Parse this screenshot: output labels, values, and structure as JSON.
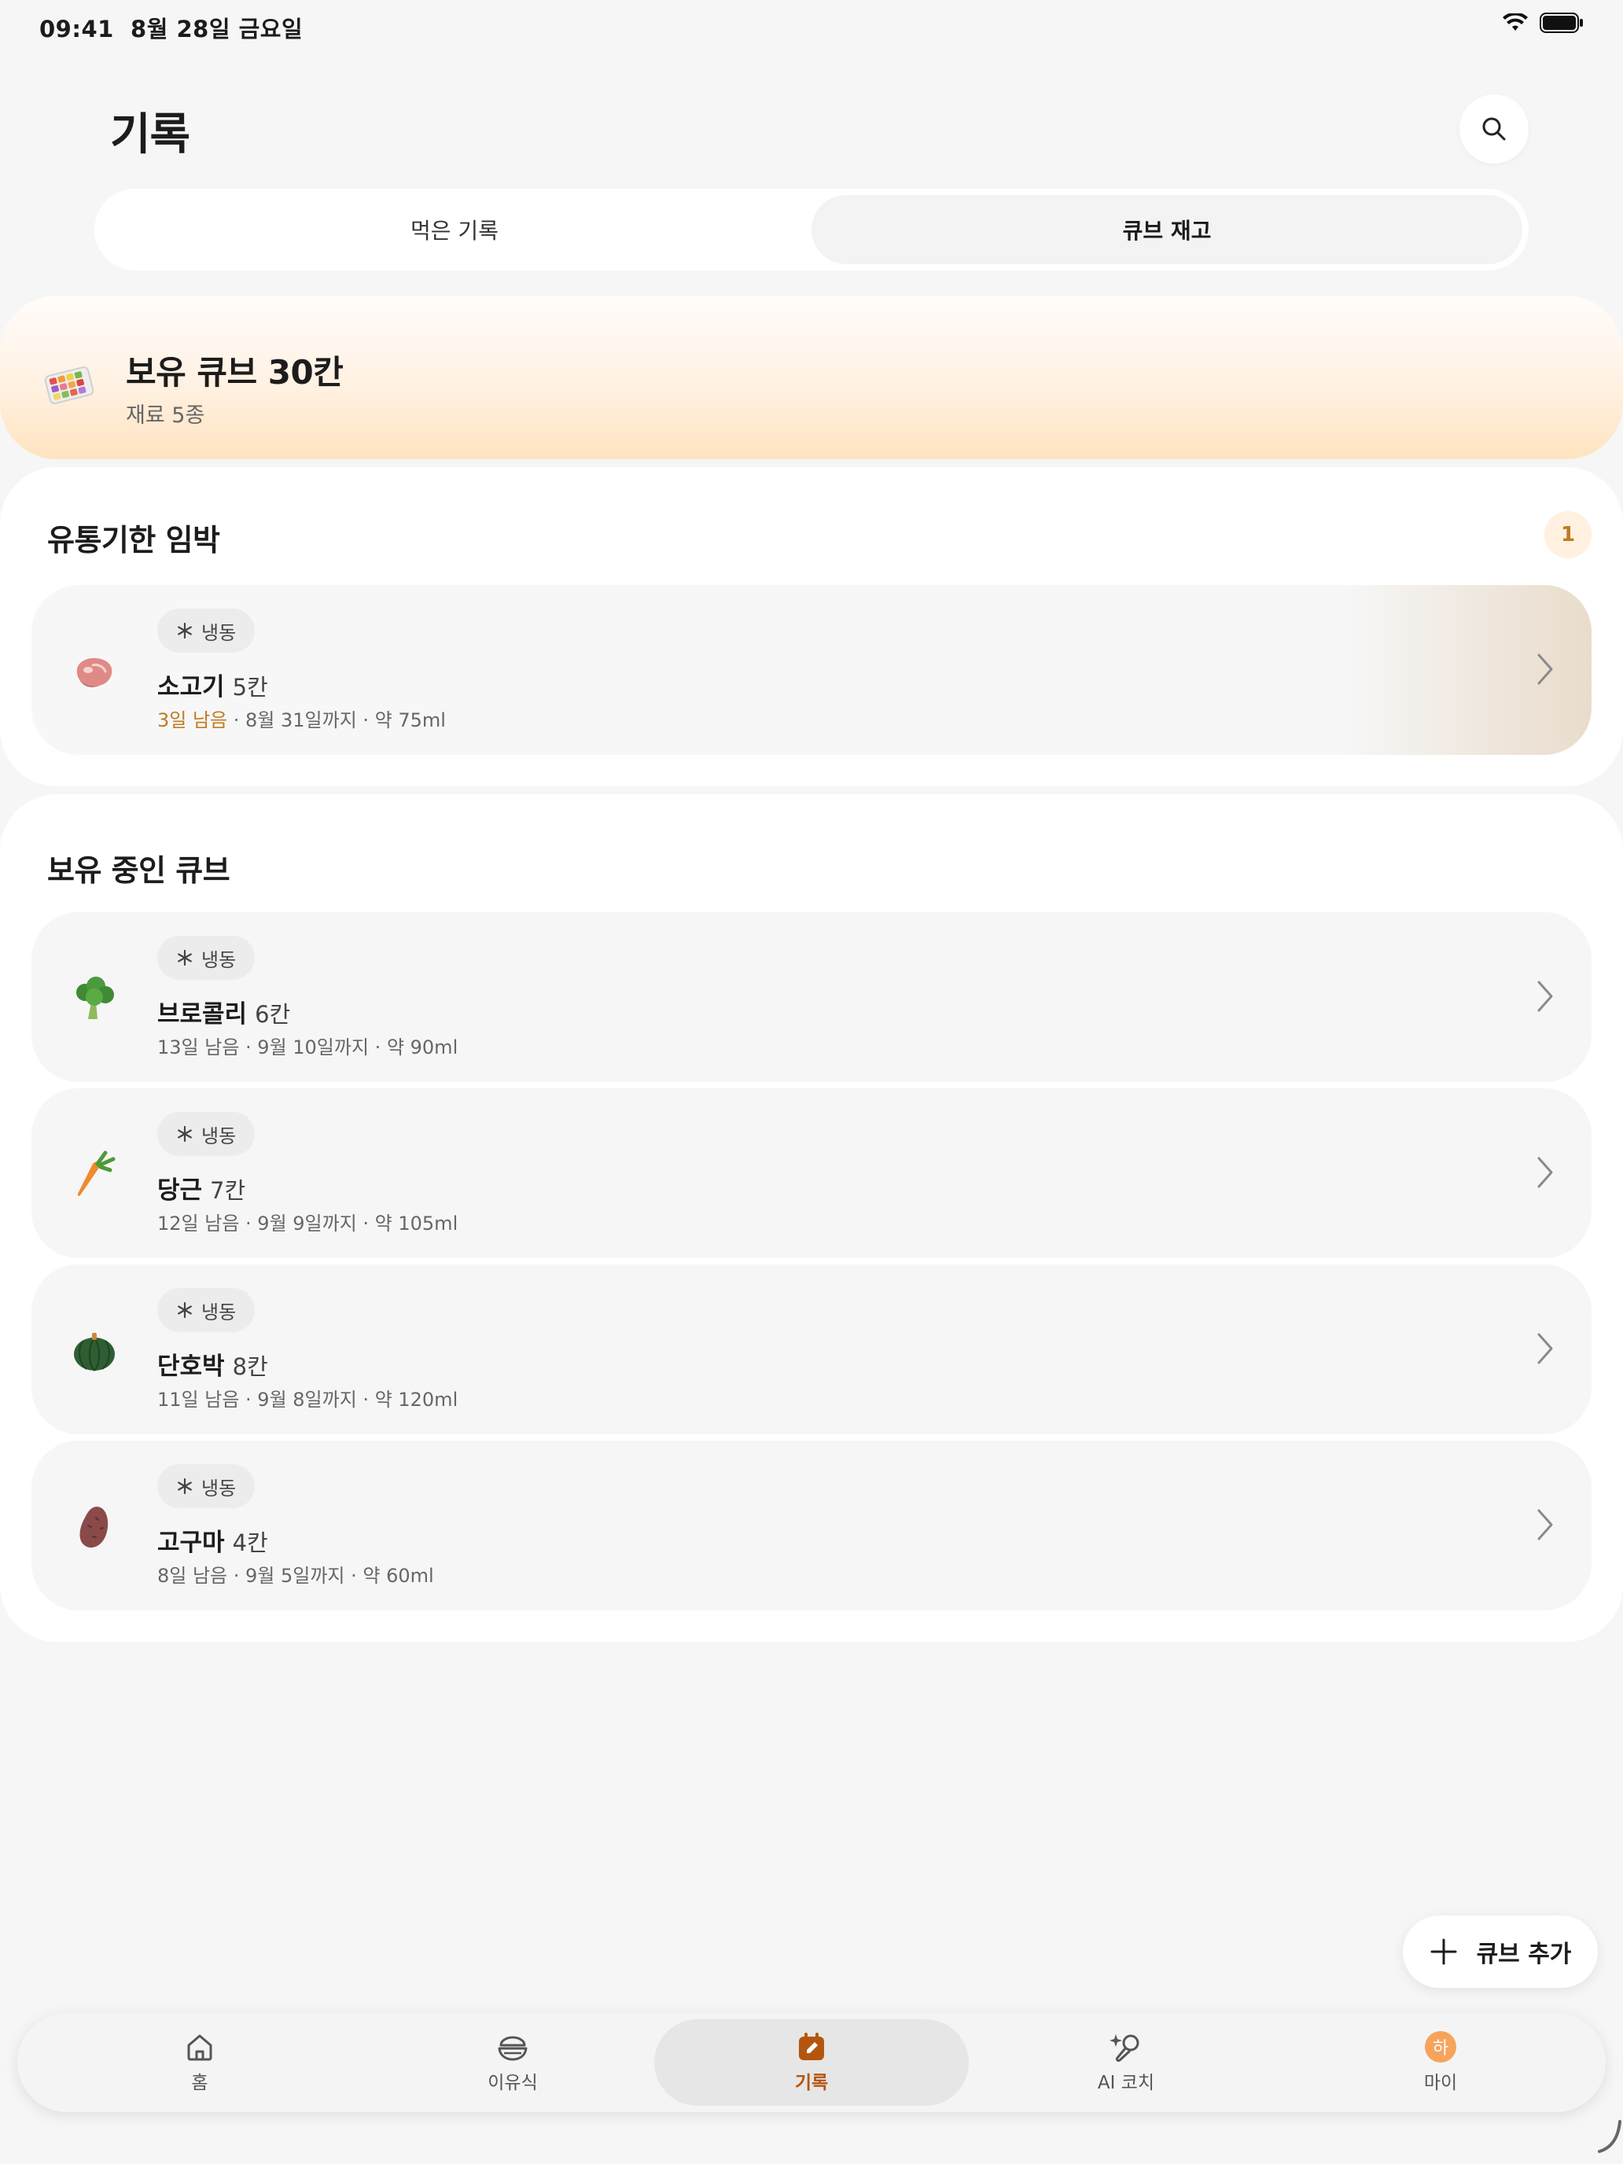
{
  "status": {
    "time": "09:41",
    "date": "8월 28일 금요일"
  },
  "header": {
    "title": "기록"
  },
  "tabs": {
    "eaten": "먹은 기록",
    "stock": "큐브 재고"
  },
  "summary": {
    "title": "보유 큐브 30칸",
    "subtitle": "재료 5종"
  },
  "expiring": {
    "title": "유통기한 임박",
    "count": "1",
    "items": [
      {
        "tag": "냉동",
        "name": "소고기",
        "count": "5칸",
        "remaining": "3일 남음",
        "details": " · 8월 31일까지 · 약 75ml"
      }
    ]
  },
  "owned": {
    "title": "보유 중인 큐브",
    "items": [
      {
        "tag": "냉동",
        "name": "브로콜리",
        "count": "6칸",
        "meta": "13일 남음 · 9월 10일까지 · 약 90ml"
      },
      {
        "tag": "냉동",
        "name": "당근",
        "count": "7칸",
        "meta": "12일 남음 · 9월 9일까지 · 약 105ml"
      },
      {
        "tag": "냉동",
        "name": "단호박",
        "count": "8칸",
        "meta": "11일 남음 · 9월 8일까지 · 약 120ml"
      },
      {
        "tag": "냉동",
        "name": "고구마",
        "count": "4칸",
        "meta": "8일 남음 · 9월 5일까지 · 약 60ml"
      }
    ]
  },
  "fab": {
    "label": "큐브 추가"
  },
  "nav": {
    "home": "홈",
    "babyfood": "이유식",
    "records": "기록",
    "coach": "AI 코치",
    "my": "마이",
    "avatar": "하"
  },
  "colors": {
    "accent": "#b4550f",
    "warning": "#c27a22",
    "summary_bg": "#ffe3bf"
  }
}
